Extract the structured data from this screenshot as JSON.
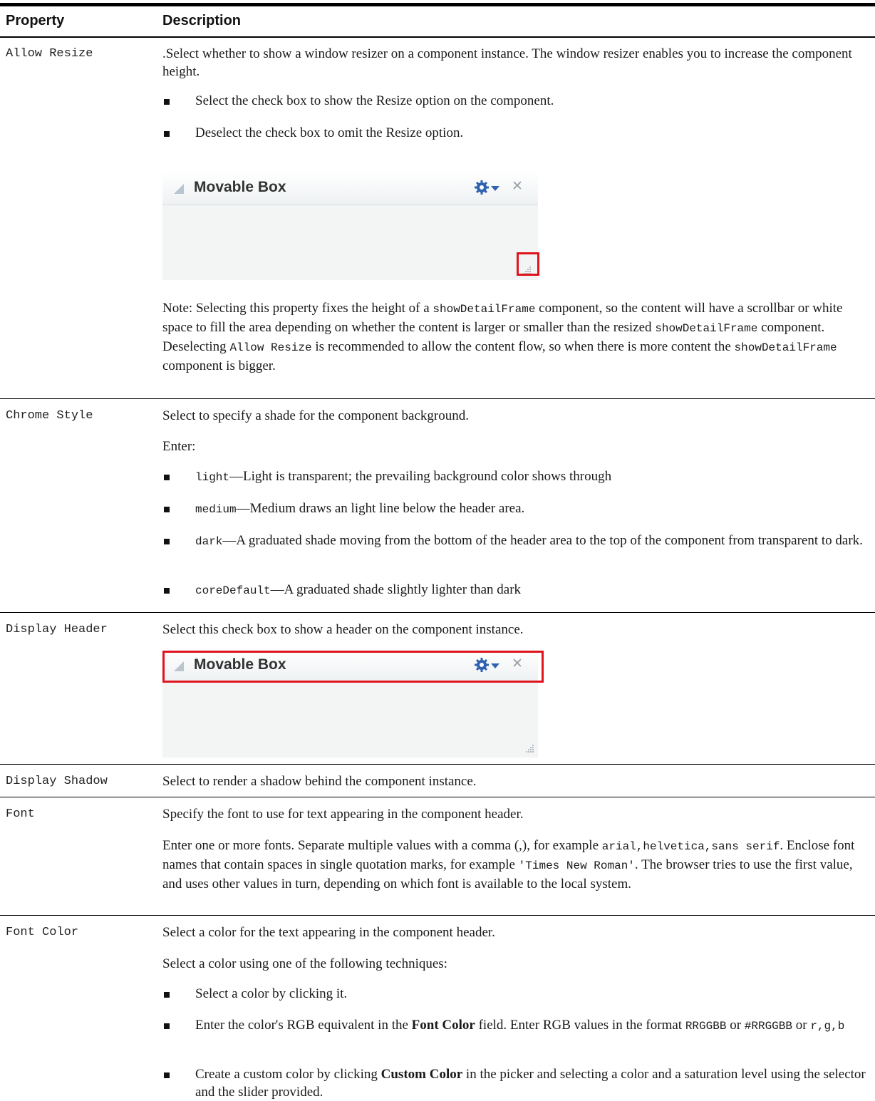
{
  "header": {
    "property": "Property",
    "description": "Description"
  },
  "rows": {
    "allow_resize": {
      "name": "Allow Resize",
      "intro": ".Select whether to show a window resizer on a component instance. The window resizer enables you to increase the component height.",
      "bullets": [
        "Select the check box to show the Resize option on the component.",
        "Deselect the check box to omit the Resize option."
      ],
      "note_1": "Note: Selecting this property fixes the height of a ",
      "note_code_1": "showDetailFrame",
      "note_2": " component, so the content will have a scrollbar or white space to fill the area depending on whether the content is larger or smaller than the resized ",
      "note_code_2": "showDetailFrame",
      "note_3": " component. Deselecting ",
      "note_code_3": "Allow Resize",
      "note_4": " is recommended to allow the content flow, so when there is more content the ",
      "note_code_4": "showDetailFrame",
      "note_5": " component is bigger."
    },
    "chrome_style": {
      "name": "Chrome Style",
      "intro": "Select to specify a shade for the component background.",
      "enter": "Enter:",
      "bullets": [
        {
          "code": "light",
          "text": "—Light is transparent; the prevailing background color shows through"
        },
        {
          "code": "medium",
          "text": "—Medium draws an light line below the header area."
        },
        {
          "code": "dark",
          "text": "—A graduated shade moving from the bottom of the header area to the top of the component from transparent to dark."
        },
        {
          "code": "coreDefault",
          "text": "—A graduated shade slightly lighter than dark"
        }
      ]
    },
    "display_header": {
      "name": "Display Header",
      "intro": "Select this check box to show a header on the component instance."
    },
    "display_shadow": {
      "name": "Display Shadow",
      "intro": "Select to render a shadow behind the component instance."
    },
    "font": {
      "name": "Font",
      "intro": "Specify the font to use for text appearing in the component header.",
      "p2_a": "Enter one or more fonts. Separate multiple values with a comma (,), for example ",
      "p2_code_1": "arial,helvetica,sans serif",
      "p2_b": ". Enclose font names that contain spaces in single quotation marks, for example ",
      "p2_code_2": "'Times New Roman'",
      "p2_c": ". The browser tries to use the first value, and uses other values in turn, depending on which font is available to the local system."
    },
    "font_color": {
      "name": "Font Color",
      "intro": "Select a color for the text appearing in the component header.",
      "p2": "Select a color using one of the following techniques:",
      "b1": "Select a color by clicking it.",
      "b2_a": "Enter the color's RGB equivalent in the ",
      "b2_bold": "Font Color",
      "b2_b": " field. Enter RGB values in the format ",
      "b2_code_1": "RRGGBB",
      "b2_or_1": " or ",
      "b2_code_2": "#RRGGBB",
      "b2_or_2": " or ",
      "b2_code_3": "r,g,b",
      "b3_a": "Create a custom color by clicking ",
      "b3_bold": "Custom Color",
      "b3_b": " in the picker and selecting a color and a saturation level using the selector and the slider provided."
    }
  },
  "movable_box": {
    "title": "Movable Box"
  },
  "colors": {
    "highlight": "#e0141e",
    "gear": "#2f62b0"
  }
}
